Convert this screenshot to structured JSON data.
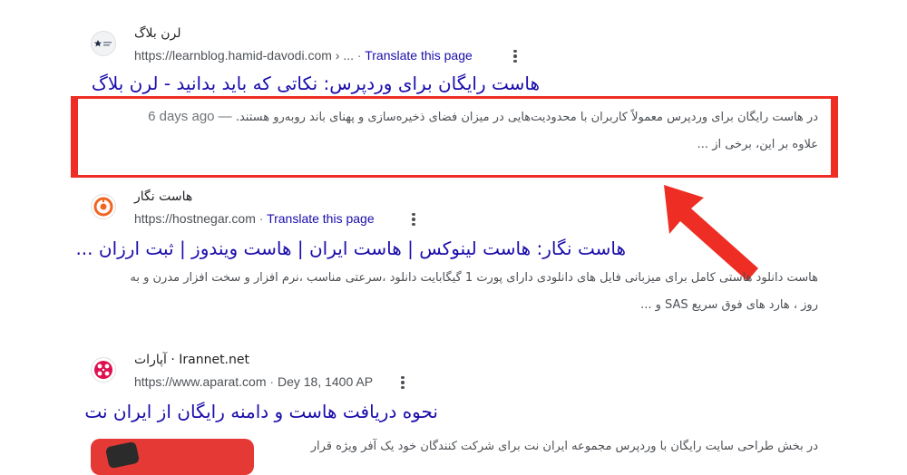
{
  "colors": {
    "link": "#1a0dab",
    "highlight": "#ee2d24",
    "arrow": "#ee2d24",
    "text": "#4d5156"
  },
  "results": [
    {
      "site_name": "لرن بلاگ",
      "favicon_text": "لرن بلاگ",
      "icon": "star-logo-icon",
      "url": "https://learnblog.hamid-davodi.com › ...",
      "separator": "·",
      "translate": "Translate this page",
      "title": "هاست رایگان برای وردپرس: نکاتی که باید بدانید - لرن بلاگ",
      "snippet_date": "6 days ago —",
      "snippet_line1": "در هاست رایگان برای وردپرس معمولاً کاربران با محدودیت‌هایی در میزان فضای ذخیره‌سازی و پهنای باند روبه‌رو هستند.",
      "snippet_line2": "علاوه بر این، برخی از ..."
    },
    {
      "site_name": "هاست نگار",
      "icon": "hostnegar-logo-icon",
      "url": "https://hostnegar.com",
      "separator": "·",
      "translate": "Translate this page",
      "title": "هاست نگار: هاست لینوکس | هاست ایران | هاست ویندوز | ثبت ارزان ...",
      "snippet_line1": "هاست دانلود هاستی کامل برای میزبانی فایل های دانلودی دارای پورت 1 گیگابایت دانلود ،سرعتی مناسب ،نرم افزار و سخت افزار مدرن و به",
      "snippet_line2": "روز ، هارد های فوق سریع SAS و ..."
    },
    {
      "site_name": "آپارات · Irannet.net",
      "icon": "aparat-logo-icon",
      "url": "https://www.aparat.com",
      "date": "Dey 18, 1400 AP",
      "separator": "·",
      "title": "نحوه دریافت هاست و دامنه رایگان از ایران نت",
      "snippet_line1": "در بخش طراحی سایت رایگان با وردپرس مجموعه ایران نت برای شرکت کنندگان خود یک آفر ویژه قرار"
    }
  ]
}
